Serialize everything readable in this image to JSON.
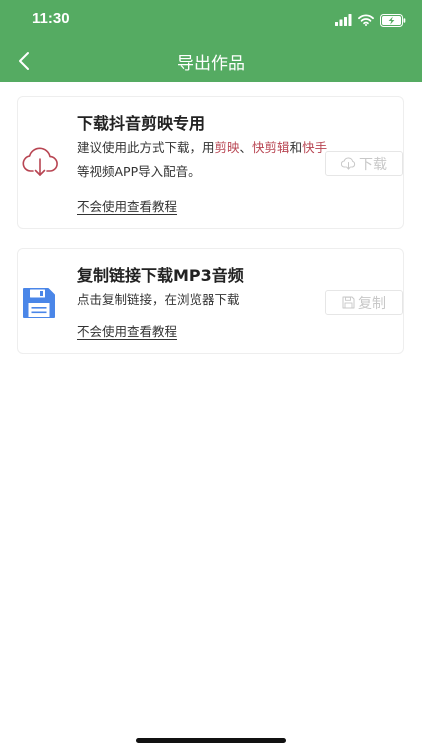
{
  "status_bar": {
    "time": "11:30"
  },
  "nav": {
    "title": "导出作品",
    "back_icon": "chevron-left-icon"
  },
  "cards": [
    {
      "icon": "cloud-download-icon",
      "icon_color": "#b84552",
      "title": "下载抖音剪映专用",
      "desc_parts": [
        {
          "text": "建议使用此方式下载，用",
          "highlight": false
        },
        {
          "text": "剪映",
          "highlight": true
        },
        {
          "text": "、",
          "highlight": false
        },
        {
          "text": "快剪辑",
          "highlight": true
        },
        {
          "text": "和",
          "highlight": false
        },
        {
          "text": "快手",
          "highlight": true
        },
        {
          "text": "等视频APP导入配音。",
          "highlight": false
        }
      ],
      "tutorial_link": "不会使用查看教程",
      "action_label": "下载",
      "action_icon": "cloud-download-icon"
    },
    {
      "icon": "floppy-save-icon",
      "icon_color": "#4a86e8",
      "title": "复制链接下载MP3音频",
      "desc": "点击复制链接，在浏览器下载",
      "tutorial_link": "不会使用查看教程",
      "action_label": "复制",
      "action_icon": "save-icon"
    }
  ],
  "colors": {
    "header": "#55ab62",
    "highlight": "#b84552",
    "disabled_text": "#c8c8c8"
  }
}
